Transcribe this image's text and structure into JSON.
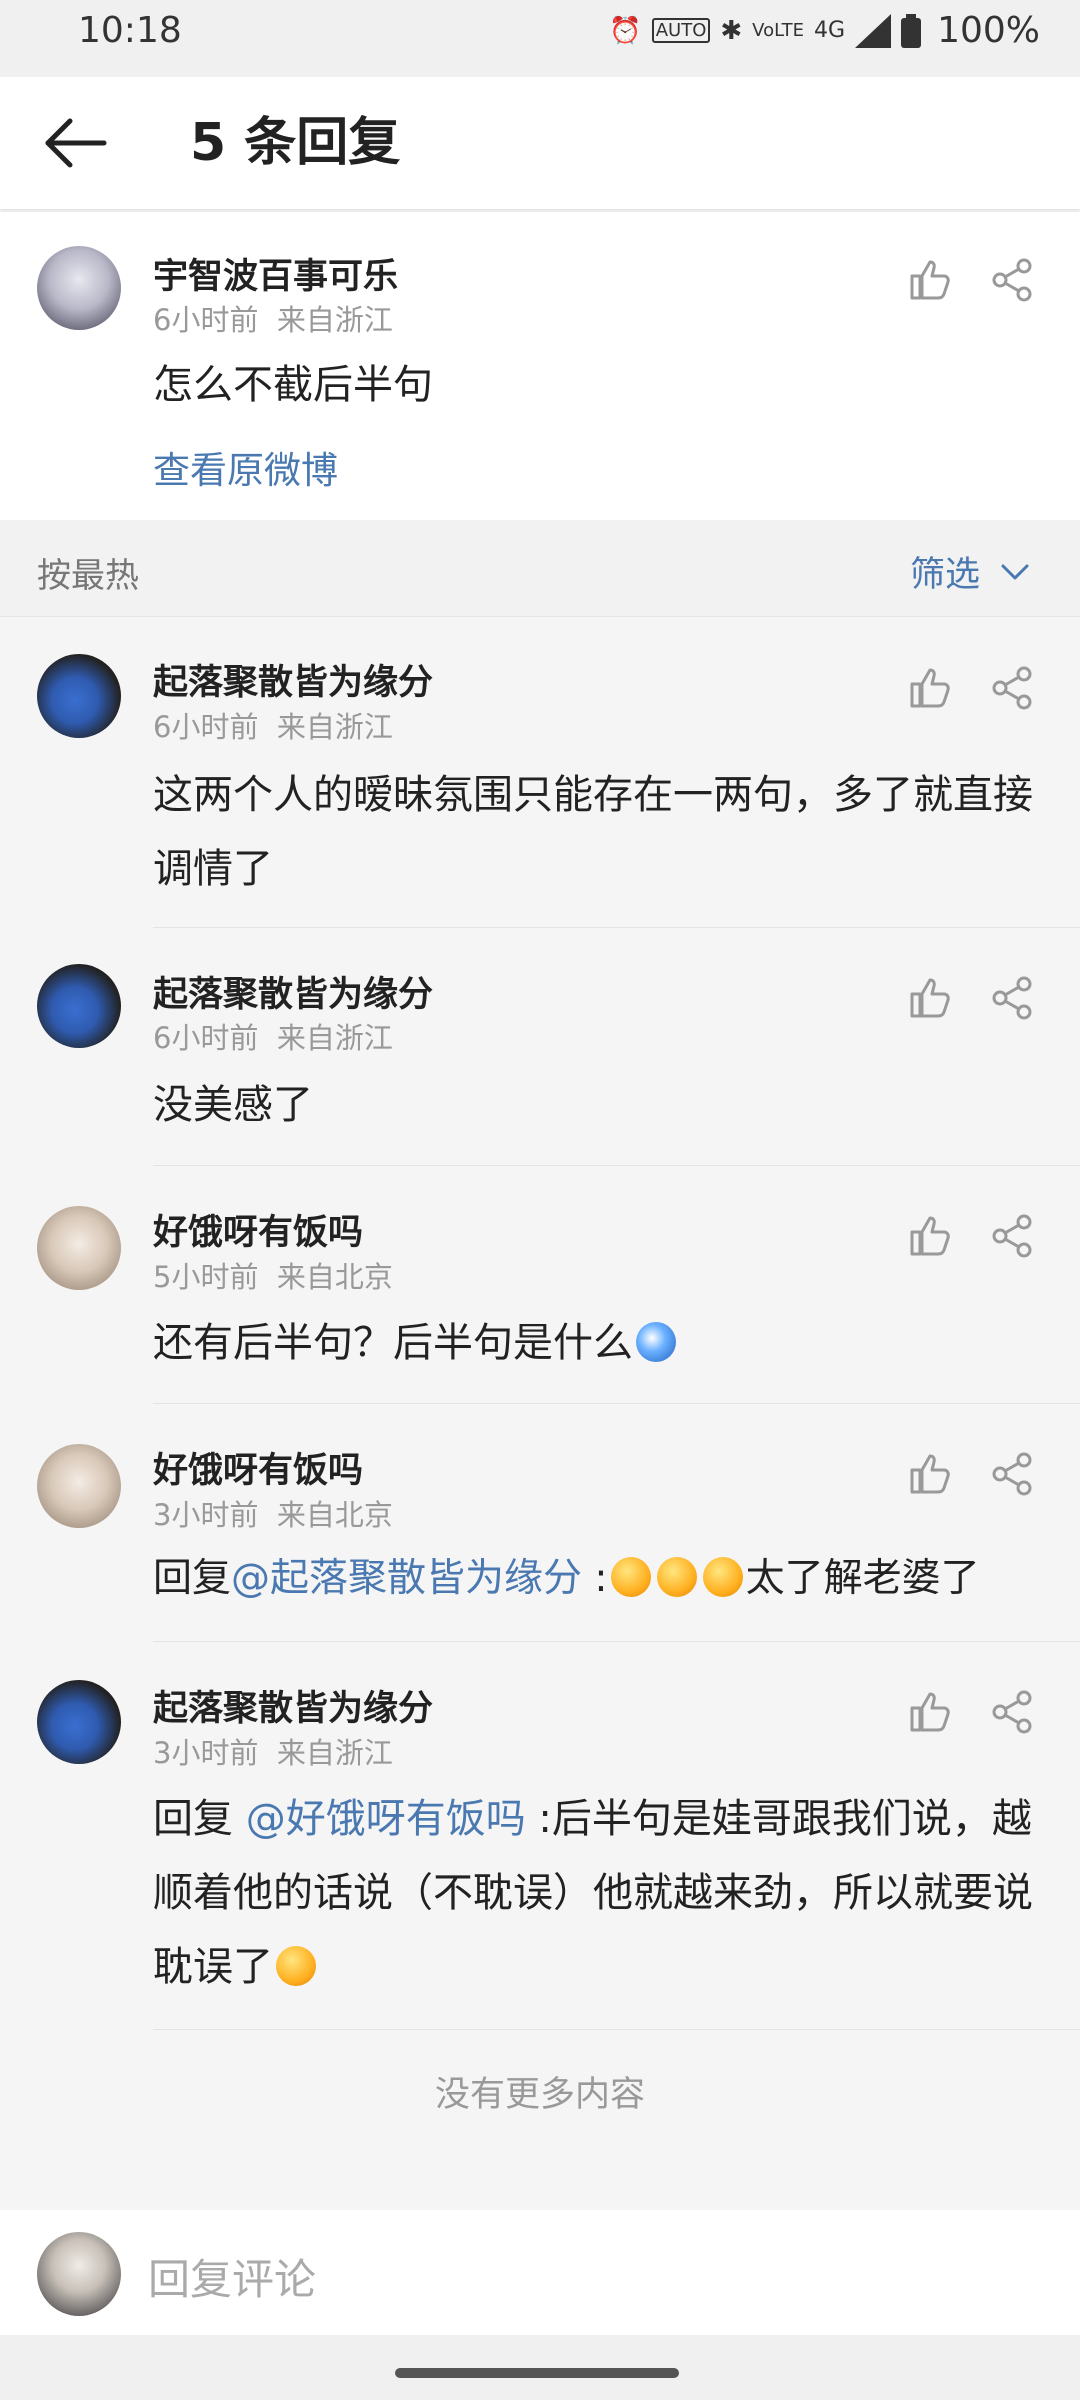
{
  "status_bar": {
    "time": "10:18",
    "icons": [
      "alarm-icon",
      "auto-hd-icon",
      "bluetooth-icon",
      "volte-icon",
      "4g-icon",
      "signal-icon",
      "battery-icon"
    ],
    "network": "4G",
    "battery": "100%"
  },
  "header": {
    "title": "5 条回复"
  },
  "root_comment": {
    "name": "宇智波百事可乐",
    "time": "6小时前",
    "location": "来自浙江",
    "text": "怎么不截后半句",
    "view_original": "查看原微博"
  },
  "sort_bar": {
    "label": "按最热",
    "filter_label": "筛选"
  },
  "replies": [
    {
      "name": "起落聚散皆为缘分",
      "time": "6小时前",
      "location": "来自浙江",
      "text": "这两个人的暧昧氛围只能存在一两句，多了就直接调情了"
    },
    {
      "name": "起落聚散皆为缘分",
      "time": "6小时前",
      "location": "来自浙江",
      "text": "没美感了"
    },
    {
      "name": "好饿呀有饭吗",
      "time": "5小时前",
      "location": "来自北京",
      "text": "还有后半句？后半句是什么"
    },
    {
      "name": "好饿呀有饭吗",
      "time": "3小时前",
      "location": "来自北京",
      "prefix": "回复",
      "mention": "@起落聚散皆为缘分",
      "text": " :",
      "suffix": "太了解老婆了"
    },
    {
      "name": "起落聚散皆为缘分",
      "time": "3小时前",
      "location": "来自浙江",
      "prefix": "回复 ",
      "mention": "@好饿呀有饭吗",
      "text": " :后半句是娃哥跟我们说，越顺着他的话说（不耽误）他就越来劲，所以就要说耽误了"
    }
  ],
  "no_more": "没有更多内容",
  "bottom_bar": {
    "placeholder": "回复评论"
  },
  "colors": {
    "link": "#4a78b0",
    "meta": "#999999",
    "background": "#f5f5f5"
  }
}
